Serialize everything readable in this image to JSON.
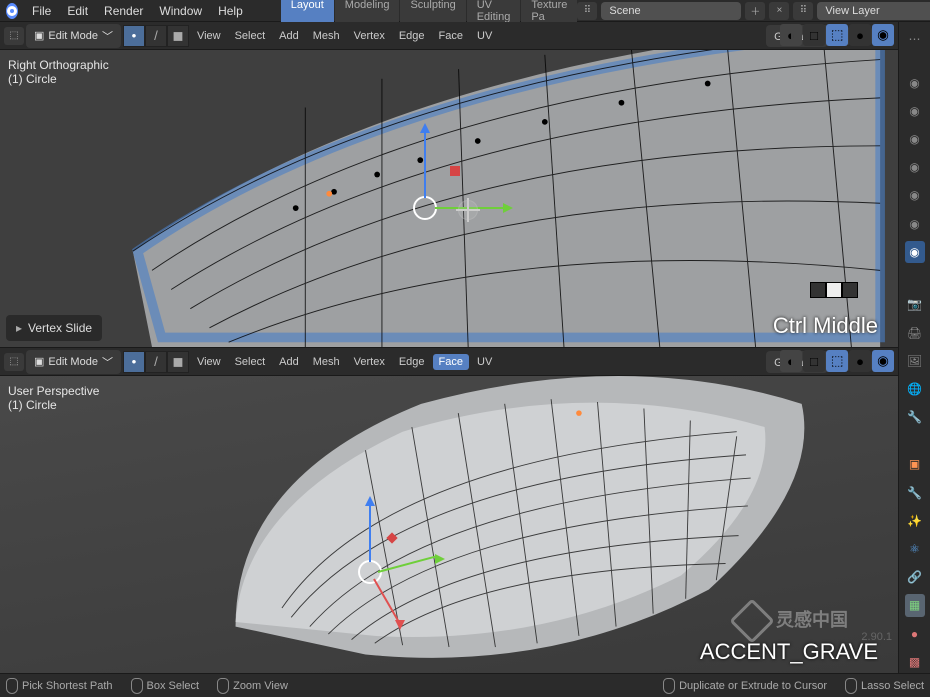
{
  "top_menu": {
    "items": [
      "File",
      "Edit",
      "Render",
      "Window",
      "Help"
    ]
  },
  "workspaces": {
    "tabs": [
      "Layout",
      "Modeling",
      "Sculpting",
      "UV Editing",
      "Texture Pa"
    ],
    "active": 0
  },
  "scene": {
    "scene_name": "Scene",
    "layer_name": "View Layer"
  },
  "viewport1": {
    "mode": "Edit Mode",
    "menus": [
      "View",
      "Select",
      "Add",
      "Mesh",
      "Vertex",
      "Edge",
      "Face",
      "UV"
    ],
    "orientation": "Global",
    "info_line1": "Right Orthographic",
    "info_line2": "(1) Circle",
    "last_op": "Vertex Slide",
    "screencast": "Ctrl Middle"
  },
  "viewport2": {
    "mode": "Edit Mode",
    "menus": [
      "View",
      "Select",
      "Add",
      "Mesh",
      "Vertex",
      "Edge",
      "Face",
      "UV"
    ],
    "orientation": "Global",
    "active_menu": 6,
    "info_line1": "User Perspective",
    "info_line2": "(1) Circle",
    "screencast": "ACCENT_GRAVE"
  },
  "status": {
    "items": [
      "Pick Shortest Path",
      "Box Select",
      "Zoom View",
      "Duplicate or Extrude to Cursor",
      "Lasso Select"
    ]
  },
  "version": "2.90.1",
  "watermark": "灵感中国"
}
